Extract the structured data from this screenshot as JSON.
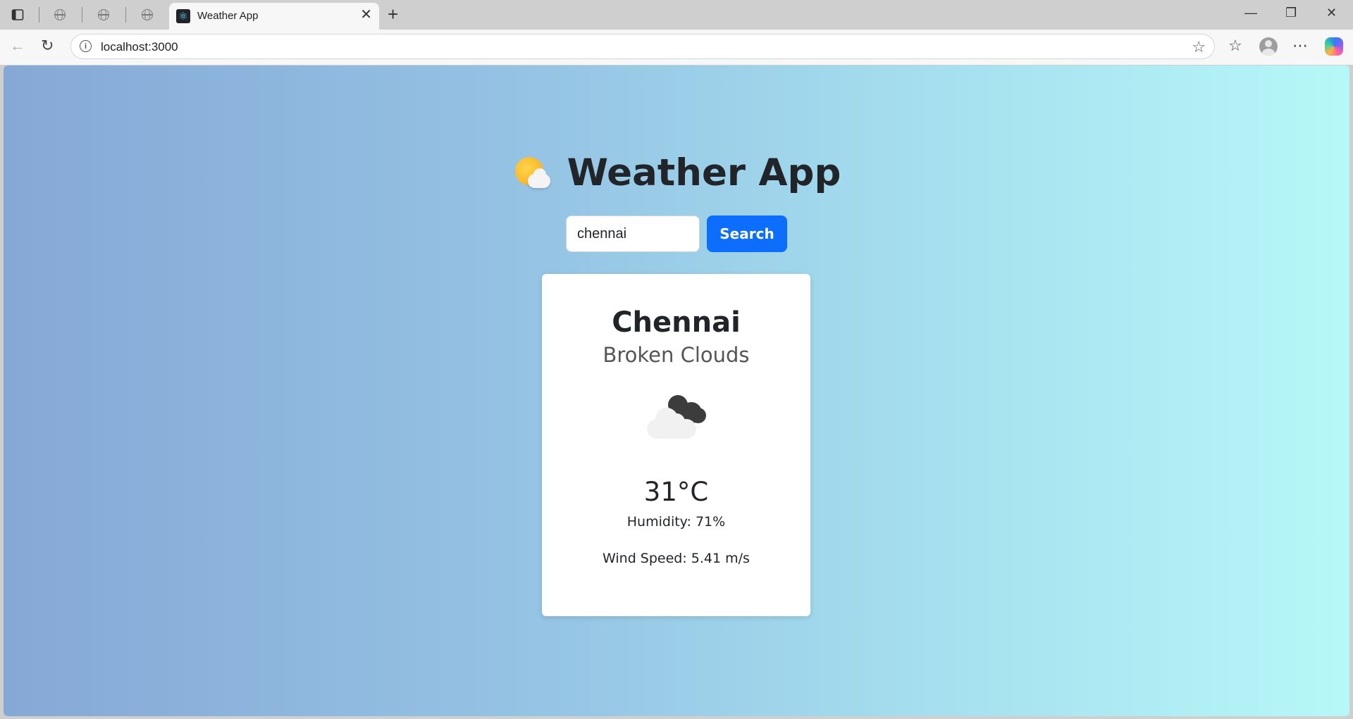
{
  "browser": {
    "tab_title": "Weather App",
    "url": "localhost:3000"
  },
  "app": {
    "title": "Weather App",
    "title_icon": "sun-behind-cloud-icon",
    "search": {
      "value": "chennai",
      "button_label": "Search"
    },
    "weather": {
      "city": "Chennai",
      "description": "Broken Clouds",
      "icon": "broken-clouds-icon",
      "temperature": "31°C",
      "humidity": "Humidity: 71%",
      "wind_speed": "Wind Speed: 5.41 m/s"
    }
  },
  "colors": {
    "accent": "#0d6efd",
    "gradient_start": "#86a8d6",
    "gradient_end": "#b6f8f8"
  }
}
